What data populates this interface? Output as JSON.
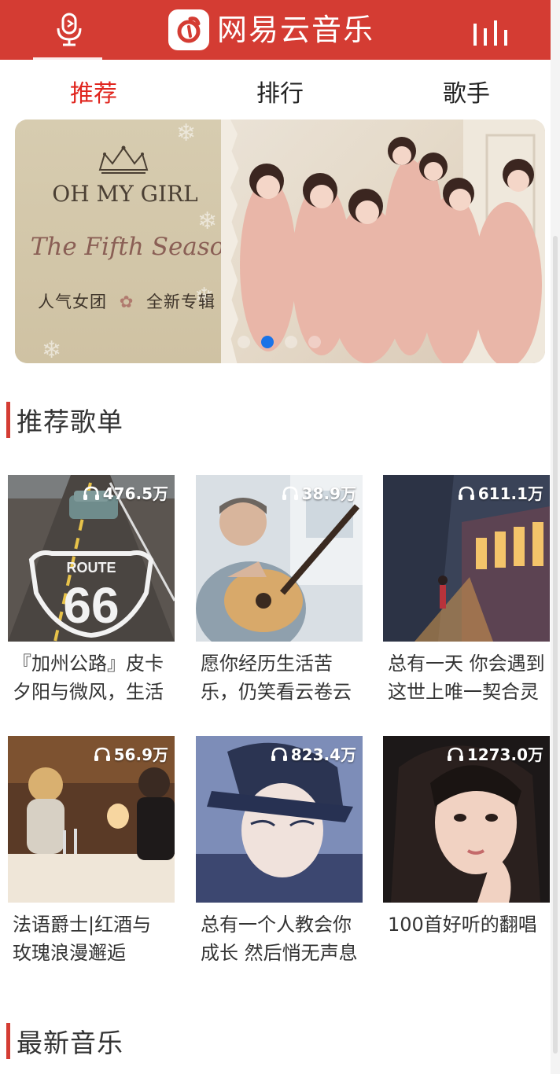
{
  "header": {
    "logo_text": "网易云音乐",
    "brand_color": "#d43c33",
    "left_icon": "microphone-icon",
    "right_icon": "equalizer-bars-icon"
  },
  "tabs": [
    {
      "label": "推荐",
      "active": true
    },
    {
      "label": "排行",
      "active": false
    },
    {
      "label": "歌手",
      "active": false
    }
  ],
  "banner": {
    "title": "OH MY GIRL",
    "subtitle": "The Fifth Season",
    "tagline_left": "人气女团",
    "tagline_right": "全新专辑",
    "dot_count": 4,
    "active_dot": 1
  },
  "sections": {
    "recommended": "推荐歌单",
    "latest": "最新音乐"
  },
  "playlists": [
    {
      "title": "『加州公路』皮卡夕阳与微风，生活",
      "count": "476.5万",
      "cover": "route-66-road"
    },
    {
      "title": "愿你经历生活苦乐，仍笑看云卷云",
      "count": "38.9万",
      "cover": "guitar-player"
    },
    {
      "title": "总有一天 你会遇到这世上唯一契合灵",
      "count": "611.1万",
      "cover": "night-train-station"
    },
    {
      "title": "法语爵士|红酒与玫瑰浪漫邂逅",
      "count": "56.9万",
      "cover": "candlelit-dinner"
    },
    {
      "title": "总有一个人教会你成长 然后悄无声息",
      "count": "823.4万",
      "cover": "anime-boy"
    },
    {
      "title": "100首好听的翻唱",
      "count": "1273.0万",
      "cover": "portrait-girl"
    }
  ]
}
